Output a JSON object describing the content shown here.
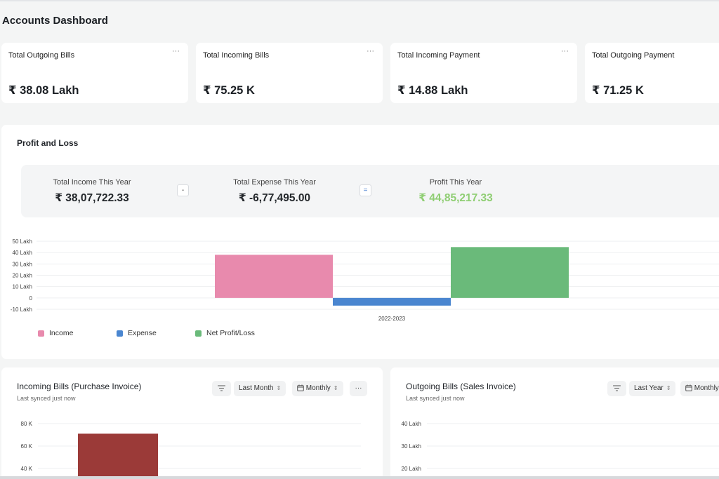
{
  "page": {
    "title": "Accounts Dashboard"
  },
  "stat_cards": [
    {
      "title": "Total Outgoing Bills",
      "value": "₹ 38.08 Lakh",
      "menu": "···"
    },
    {
      "title": "Total Incoming Bills",
      "value": "₹ 75.25 K",
      "menu": "···"
    },
    {
      "title": "Total Incoming Payment",
      "value": "₹ 14.88 Lakh",
      "menu": "···"
    },
    {
      "title": "Total Outgoing Payment",
      "value": "₹ 71.25 K"
    }
  ],
  "profit_loss": {
    "title": "Profit and Loss",
    "income_label": "Total Income This Year",
    "income_value": "₹ 38,07,722.33",
    "minus_symbol": "-",
    "expense_label": "Total Expense This Year",
    "expense_value": "₹ -6,77,495.00",
    "equals_symbol": "=",
    "profit_label": "Profit This Year",
    "profit_value": "₹ 44,85,217.33",
    "colors": {
      "profit_text": "#8fce73"
    }
  },
  "chart_data": [
    {
      "type": "bar",
      "title": "",
      "categories": [
        "2022-2023"
      ],
      "y_tick_labels": [
        "50 Lakh",
        "40 Lakh",
        "30 Lakh",
        "20 Lakh",
        "10 Lakh",
        "0",
        "-10 Lakh"
      ],
      "ylim": [
        -1000000,
        5000000
      ],
      "series": [
        {
          "name": "Income",
          "values": [
            3807722.33
          ],
          "color": "#e88aad"
        },
        {
          "name": "Expense",
          "values": [
            -677495.0
          ],
          "color": "#4a86d0"
        },
        {
          "name": "Net Profit/Loss",
          "values": [
            4485217.33
          ],
          "color": "#6aba7a"
        }
      ],
      "legend": [
        "Income",
        "Expense",
        "Net Profit/Loss"
      ],
      "legend_position": "bottom-left",
      "grid": true
    },
    {
      "type": "bar",
      "title": "",
      "y_tick_labels": [
        "80 K",
        "60 K",
        "40 K"
      ],
      "series": [
        {
          "values": [
            71000
          ],
          "color": "#9b3a38"
        }
      ],
      "grid": true
    },
    {
      "type": "bar",
      "title": "",
      "y_tick_labels": [
        "40 Lakh",
        "30 Lakh",
        "20 Lakh"
      ],
      "series": [],
      "grid": true
    }
  ],
  "incoming_bills": {
    "title": "Incoming Bills (Purchase Invoice)",
    "subtitle": "Last synced just now",
    "period": "Last Month",
    "interval": "Monthly",
    "more": "···"
  },
  "outgoing_bills": {
    "title": "Outgoing Bills (Sales Invoice)",
    "subtitle": "Last synced just now",
    "period": "Last Year",
    "interval": "Monthly"
  },
  "icons": [
    "filter-icon",
    "calendar-icon",
    "sort-icon",
    "more-icon"
  ]
}
